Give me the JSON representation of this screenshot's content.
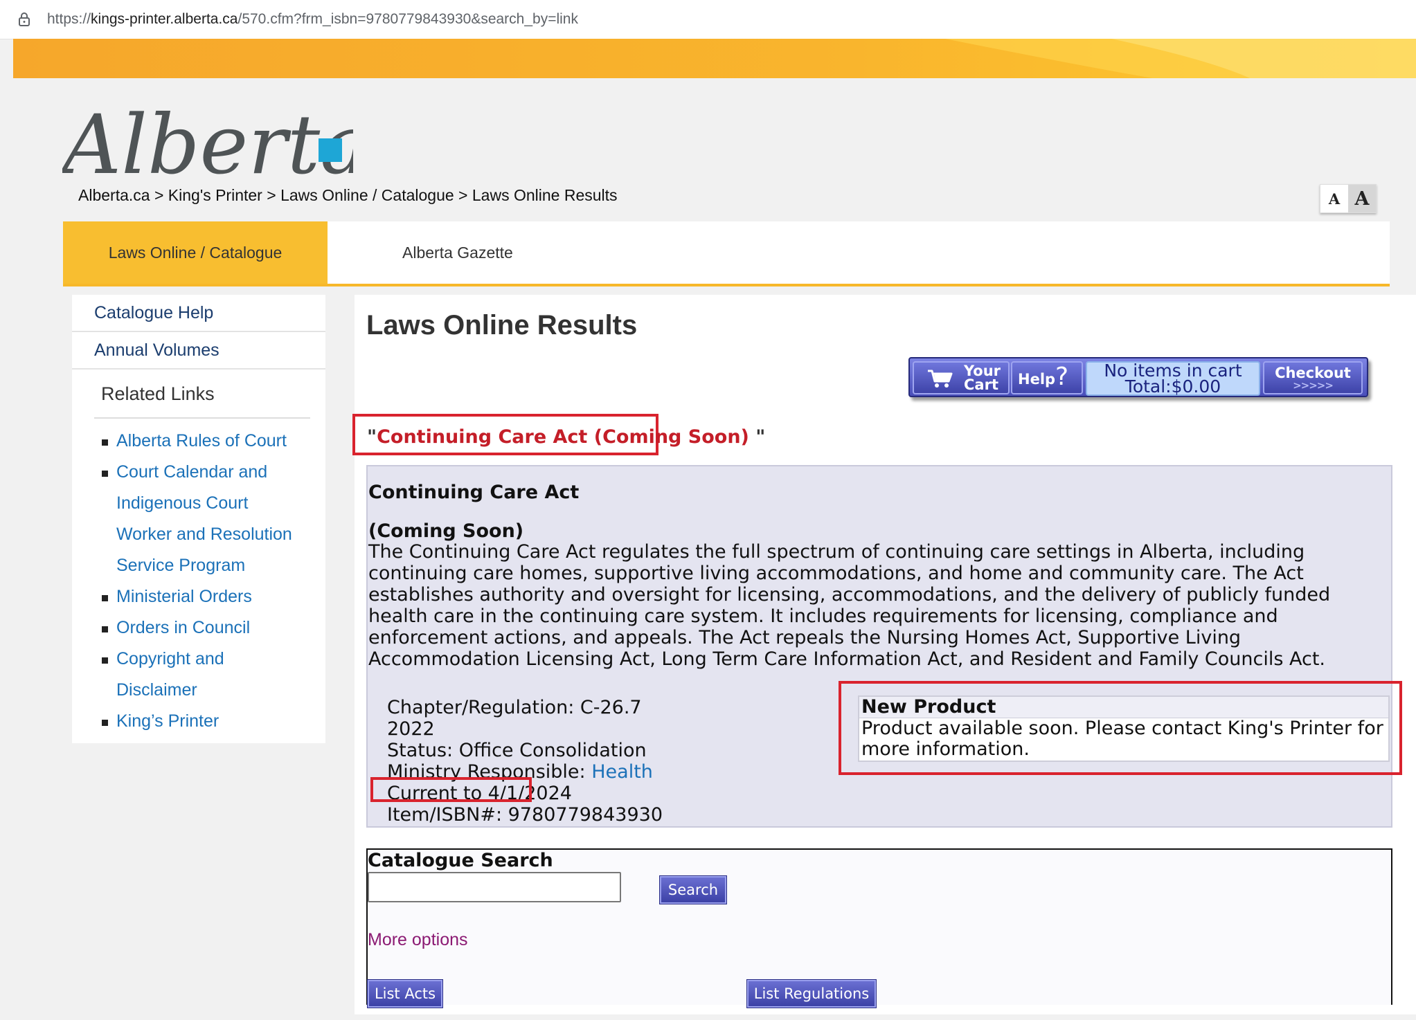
{
  "browser": {
    "url_prefix": "https://",
    "url_host": "kings-printer.alberta.ca",
    "url_path": "/570.cfm?frm_isbn=9780779843930&search_by=link"
  },
  "header": {
    "logo_text": "Alberta",
    "breadcrumb": [
      "Alberta.ca",
      "King's Printer",
      "Laws Online / Catalogue",
      "Laws Online Results"
    ],
    "breadcrumb_sep1": " > ",
    "breadcrumb_sep2": " > ",
    "breadcrumb_sep3": " > ",
    "font_small": "A",
    "font_large": "A"
  },
  "nav": {
    "tabs": [
      {
        "label": "Laws Online / Catalogue",
        "active": true
      },
      {
        "label": "Alberta Gazette",
        "active": false
      }
    ]
  },
  "sidebar": {
    "links": [
      "Catalogue Help",
      "Annual Volumes"
    ],
    "related_title": "Related Links",
    "related": [
      "Alberta Rules of Court",
      "Court Calendar and",
      "Indigenous Court",
      "Worker and Resolution",
      "Service Program",
      "Ministerial Orders",
      "Orders in Council",
      "Copyright and",
      "Disclaimer",
      "King’s Printer"
    ]
  },
  "main": {
    "title": "Laws Online Results",
    "cart": {
      "your": "Your",
      "cart": "Cart",
      "help": "Help",
      "help_q": "?",
      "status_line1": "No items in cart",
      "status_line2": "Total:$0.00",
      "checkout": "Checkout",
      "checkout_arrows": ">>>>>"
    },
    "product_title_open": "\"",
    "product_title": "Continuing Care Act (Coming Soon)",
    "product_title_close": " \"",
    "detail": {
      "name": "Continuing Care Act",
      "subtitle": "(Coming Soon)",
      "description": "The Continuing Care Act regulates the full spectrum of continuing care settings in Alberta, including continuing care homes, supportive living accommodations, and home and community care. The Act establishes authority and oversight for licensing, accommodations, and the delivery of publicly funded health care in the continuing care system. It includes requirements for licensing, compliance and enforcement actions, and appeals. The Act repeals the Nursing Homes Act, Supportive Living Accommodation Licensing Act, Long Term Care Information Act, and Resident and Family Councils Act.",
      "chapter": "Chapter/Regulation: C-26.7",
      "year": "2022",
      "status": "Status: Office Consolidation",
      "ministry_label": "Ministry Responsible: ",
      "ministry_link": "Health",
      "current": "Current to 4/1/2024",
      "isbn": "Item/ISBN#: 9780779843930"
    },
    "new_product": {
      "heading": "New Product",
      "body_line1": "Product available soon. Please contact King's Printer for",
      "body_line2": "more information."
    },
    "search": {
      "heading": "Catalogue Search",
      "input_value": "",
      "button": "Search",
      "more_options": "More options",
      "list_acts": "List Acts",
      "list_regulations": "List Regulations"
    }
  },
  "colors": {
    "accent_yellow": "#f8be30",
    "highlight_red": "#d9232e",
    "link_blue": "#1b71b8",
    "button_purple": "#4a4fba"
  }
}
